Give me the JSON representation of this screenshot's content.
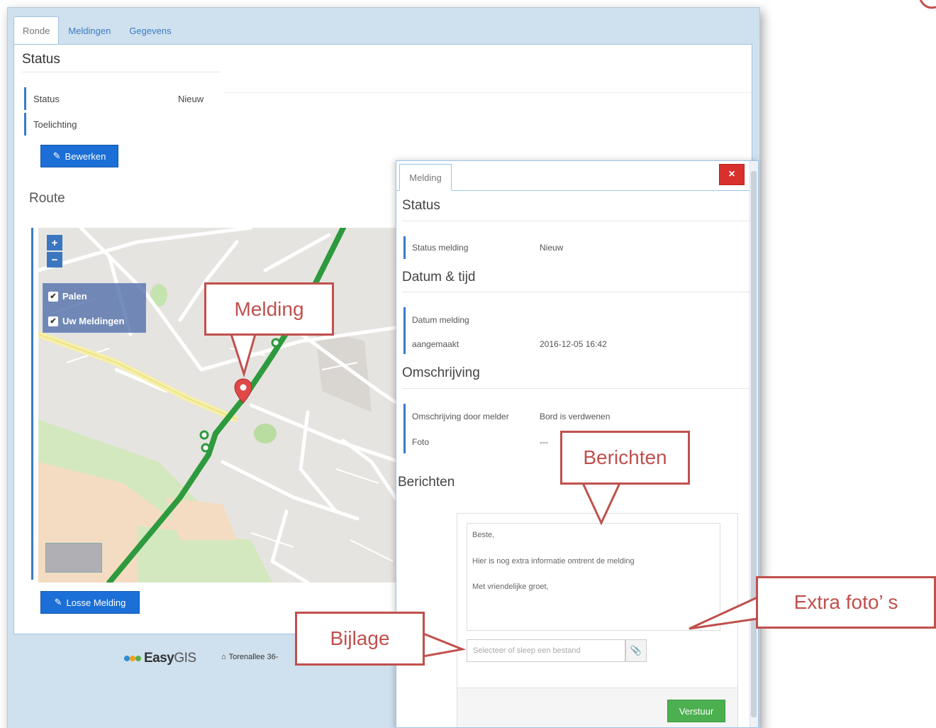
{
  "tabs": [
    {
      "label": "Ronde"
    },
    {
      "label": "Meldingen"
    },
    {
      "label": "Gegevens"
    }
  ],
  "ronde": {
    "status_heading": "Status",
    "status_label": "Status",
    "status_value": "Nieuw",
    "toelichting_label": "Toelichting",
    "edit_button": "Bewerken",
    "route_heading": "Route",
    "loose_button": "Losse Melding"
  },
  "map": {
    "zoom_in": "+",
    "zoom_out": "−",
    "layers": [
      {
        "label": "Palen",
        "checked": true
      },
      {
        "label": "Uw Meldingen",
        "checked": true
      }
    ],
    "marker_icon": "map-pin-icon"
  },
  "footer": {
    "brand_bold": "Easy",
    "brand_light": "GIS",
    "address": "Torenallee 36-"
  },
  "modal": {
    "tab": "Melding",
    "close": "×",
    "status_heading": "Status",
    "status_melding_label": "Status melding",
    "status_melding_value": "Nieuw",
    "datetime_heading": "Datum & tijd",
    "datum_melding_label": "Datum melding",
    "aangemaakt_label": "aangemaakt",
    "aangemaakt_value": "2016-12-05 16:42",
    "omschrijving_heading": "Omschrijving",
    "omschrijving_label": "Omschrijving door melder",
    "omschrijving_value": "Bord is verdwenen",
    "foto_label": "Foto",
    "foto_value": "---",
    "berichten_heading": "Berichten",
    "message_lines": [
      "Beste,",
      "Hier is nog extra informatie omtrent de melding",
      "Met vriendelijke groet,"
    ],
    "file_placeholder": "Selecteer of sleep een bestand",
    "send_button": "Verstuur"
  },
  "callouts": {
    "melding": "Melding",
    "berichten": "Berichten",
    "extra_fotos": "Extra foto’ s",
    "bijlage": "Bijlage"
  },
  "colors": {
    "accent_blue": "#3a7cc8",
    "button_blue": "#1b6fd6",
    "close_red": "#d9302b",
    "send_green": "#4cb050",
    "callout_red": "#c0504d",
    "route_green": "#2e9a3e"
  }
}
